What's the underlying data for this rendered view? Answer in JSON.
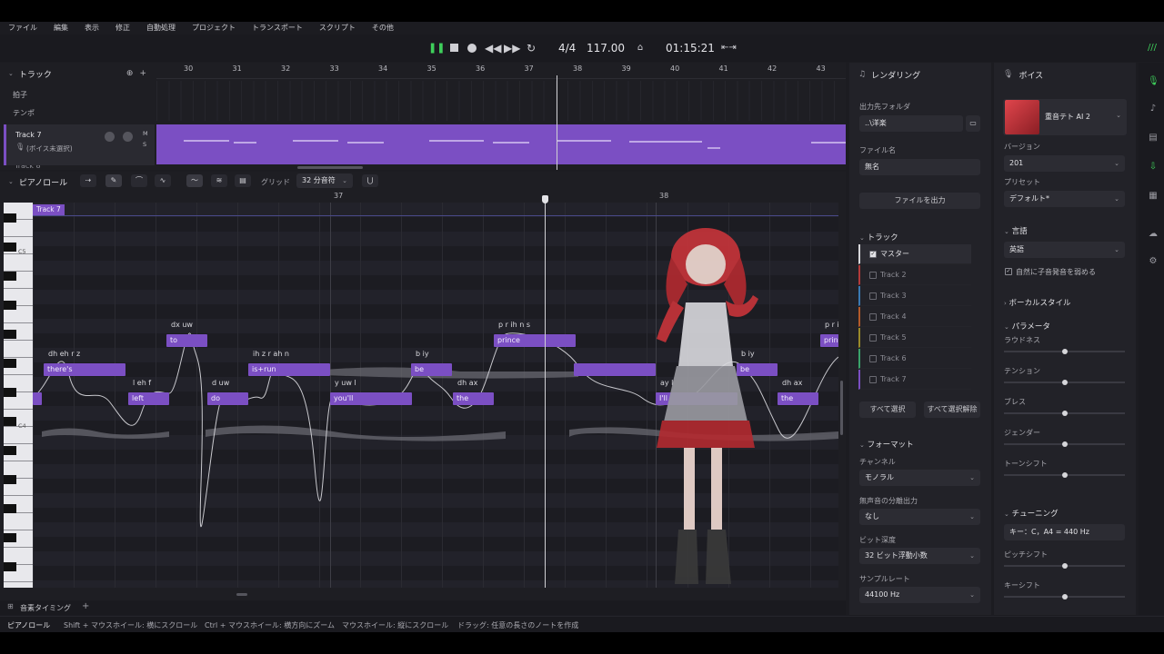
{
  "menu": [
    "ファイル",
    "編集",
    "表示",
    "修正",
    "自動処理",
    "プロジェクト",
    "トランスポート",
    "スクリプト",
    "その他"
  ],
  "transport": {
    "time_signature": "4/4",
    "tempo": "117.00",
    "time": "01:15:21"
  },
  "tracks_header": {
    "title": "トラック"
  },
  "ruler": {
    "bars": [
      "30",
      "31",
      "32",
      "33",
      "34",
      "35",
      "36",
      "37",
      "38",
      "39",
      "40",
      "41",
      "42",
      "43"
    ]
  },
  "sub_tracks": [
    "拍子",
    "テンポ"
  ],
  "track7": {
    "name": "Track 7",
    "voice": "(ボイス未選択)",
    "m": "M",
    "s": "S"
  },
  "track8_partial": "Track 8",
  "pianoroll": {
    "title": "ピアノロール",
    "grid_label": "グリッド",
    "grid_value": "32 分音符",
    "bars": [
      "37",
      "38"
    ],
    "clip_label": "Track 7",
    "c5": "C5",
    "c4": "C4"
  },
  "notes": [
    {
      "lyric": "there's",
      "ph": "dh eh r z"
    },
    {
      "lyric": "left",
      "ph": "l eh f"
    },
    {
      "lyric": "to",
      "ph": "dx uw"
    },
    {
      "lyric": "do",
      "ph": "d uw"
    },
    {
      "lyric": "is+run",
      "ph": "ih z r ah n"
    },
    {
      "lyric": "you'll",
      "ph": "y uw l"
    },
    {
      "lyric": "be",
      "ph": "b iy"
    },
    {
      "lyric": "the",
      "ph": "dh ax"
    },
    {
      "lyric": "prince",
      "ph": "p r ih n s"
    },
    {
      "lyric": "I'll",
      "ph": "ay l"
    },
    {
      "lyric": "be",
      "ph": "b iy"
    },
    {
      "lyric": "the",
      "ph": "dh ax"
    },
    {
      "lyric": "prin",
      "ph": "p r i"
    }
  ],
  "bottom": {
    "tab": "音素タイミング",
    "status_mode": "ピアノロール",
    "hints": [
      "Shift + マウスホイール: 横にスクロール",
      "Ctrl + マウスホイール: 横方向にズーム",
      "マウスホイール: 縦にスクロール",
      "ドラッグ: 任意の長さのノートを作成"
    ]
  },
  "render": {
    "title": "レンダリング",
    "folder_label": "出力先フォルダ",
    "folder_value": "..\\洋楽",
    "file_label": "ファイル名",
    "file_value": "無名",
    "export_button": "ファイルを出力"
  },
  "track_list": {
    "title": "トラック",
    "items": [
      {
        "name": "マスター",
        "checked": true,
        "color": "#d6d6da"
      },
      {
        "name": "Track 2",
        "checked": false,
        "color": "#b33a3a"
      },
      {
        "name": "Track 3",
        "checked": false,
        "color": "#3a7ab3"
      },
      {
        "name": "Track 4",
        "checked": false,
        "color": "#b35a2a"
      },
      {
        "name": "Track 5",
        "checked": false,
        "color": "#9a8a2a"
      },
      {
        "name": "Track 6",
        "checked": false,
        "color": "#3aa36a"
      },
      {
        "name": "Track 7",
        "checked": false,
        "color": "#7b4fc3"
      }
    ],
    "select_all": "すべて選択",
    "deselect_all": "すべて選択解除"
  },
  "format": {
    "title": "フォーマット",
    "channel_label": "チャンネル",
    "channel_value": "モノラル",
    "split_label": "無声音の分離出力",
    "split_value": "なし",
    "bitdepth_label": "ビット深度",
    "bitdepth_value": "32 ビット浮動小数",
    "samplerate_label": "サンプルレート",
    "samplerate_value": "44100 Hz"
  },
  "voice": {
    "title": "ボイス",
    "name": "重音テト AI 2",
    "version_label": "バージョン",
    "version_value": "201",
    "preset_label": "プリセット",
    "preset_value": "デフォルト*",
    "language_section": "言語",
    "language_value": "英語",
    "consonant_label": "自然に子音発音を弱める",
    "vocal_style": "ボーカルスタイル",
    "params": "パラメータ",
    "param_items": [
      "ラウドネス",
      "テンション",
      "ブレス",
      "ジェンダー",
      "トーンシフト"
    ],
    "tuning": "チューニング",
    "key_value": "キー：C，A4 = 440 Hz",
    "pitch_shift": "ピッチシフト",
    "key_shift": "キーシフト"
  },
  "colors": {
    "accent": "#7b4fc3",
    "play": "#3ecf5b",
    "bg": "#1c1c21"
  }
}
